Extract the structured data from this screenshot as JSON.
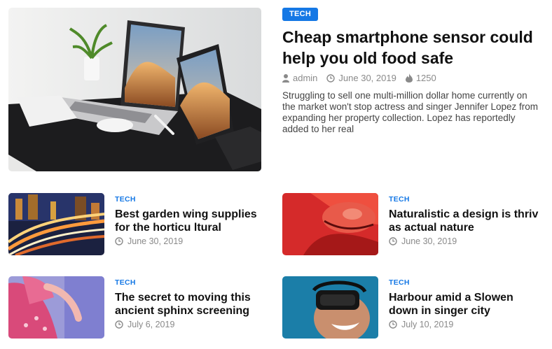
{
  "featured": {
    "category": "TECH",
    "title": "Cheap smartphone sensor could help you old food safe",
    "author": "admin",
    "date": "June 30, 2019",
    "views": "1250",
    "excerpt": "Struggling to sell one multi-million dollar home currently on the market won't stop actress and singer Jennifer Lopez from expanding her property collection. Lopez has reportedly added to her real"
  },
  "posts": [
    {
      "category": "TECH",
      "title": "Best garden wing supplies for the horticu ltural",
      "date": "June 30, 2019"
    },
    {
      "category": "TECH",
      "title": "Naturalistic a design is thriv as actual nature",
      "date": "June 30, 2019"
    },
    {
      "category": "TECH",
      "title": "The secret to moving this ancient sphinx screening",
      "date": "July 6, 2019"
    },
    {
      "category": "TECH",
      "title": "Harbour amid a Slowen down in singer city",
      "date": "July 10, 2019"
    }
  ],
  "colors": {
    "accent": "#1578e5",
    "meta": "#8a8a8a",
    "title": "#111111"
  },
  "icons": {
    "author": "user-icon",
    "date": "clock-icon",
    "views": "fire-icon"
  }
}
